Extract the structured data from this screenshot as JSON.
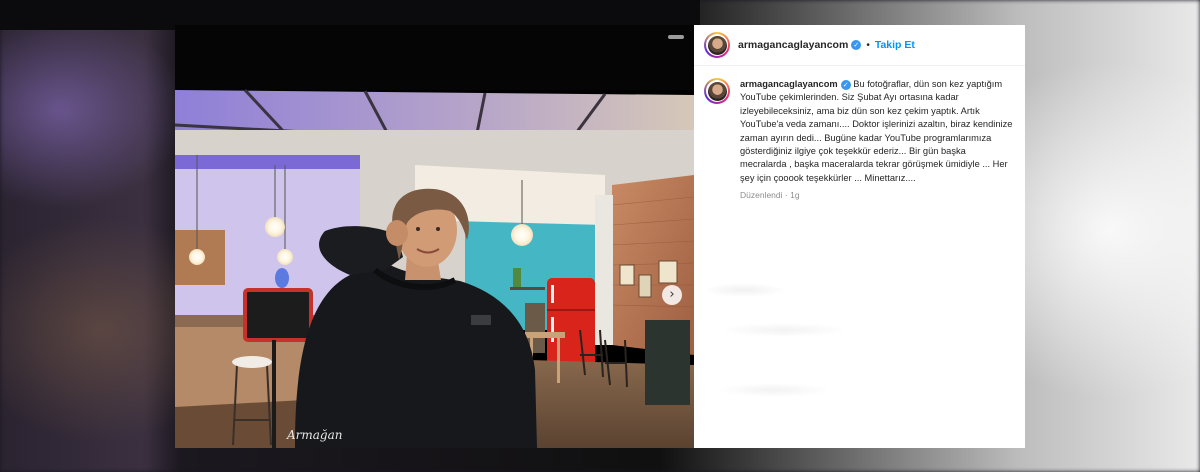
{
  "post": {
    "username": "armagancaglayancom",
    "separator": "•",
    "follow_label": "Takip Et",
    "caption_lines": [
      "Bu fotoğraflar, dün son kez yaptığım",
      "YouTube çekimlerinden. Siz Şubat Ayı ortasına kadar",
      "izleyebileceksiniz, ama biz dün son kez çekim yaptık. Artık",
      "YouTube'a veda zamanı.... Doktor işlerinizi azaltın, biraz kendinize",
      "zaman ayırın dedi... Bugüne kadar YouTube programlarımıza",
      "gösterdiğiniz ilgiye çok teşekkür ederiz... Bir gün başka",
      "mecralarda , başka maceralarda tekrar görüşmek ümidiyle ... Her",
      "şey için çooook teşekkürler ... Minettarız...."
    ],
    "edited_label": "Düzenlendi",
    "time_ago": "1g",
    "meta_separator": " · "
  },
  "photo": {
    "signature": "Armağan"
  },
  "icons": {
    "verified": "verified-badge-icon",
    "next": "chevron-right-icon",
    "avatar": "profile-avatar"
  },
  "colors": {
    "link_blue": "#0095f6",
    "verified_blue": "#3897f0",
    "text_dark": "#262626",
    "text_muted": "#8e8e8e",
    "fridge_red": "#d8241a",
    "wall_teal": "#45b7c4",
    "ceiling_purple": "#9b86e0"
  }
}
